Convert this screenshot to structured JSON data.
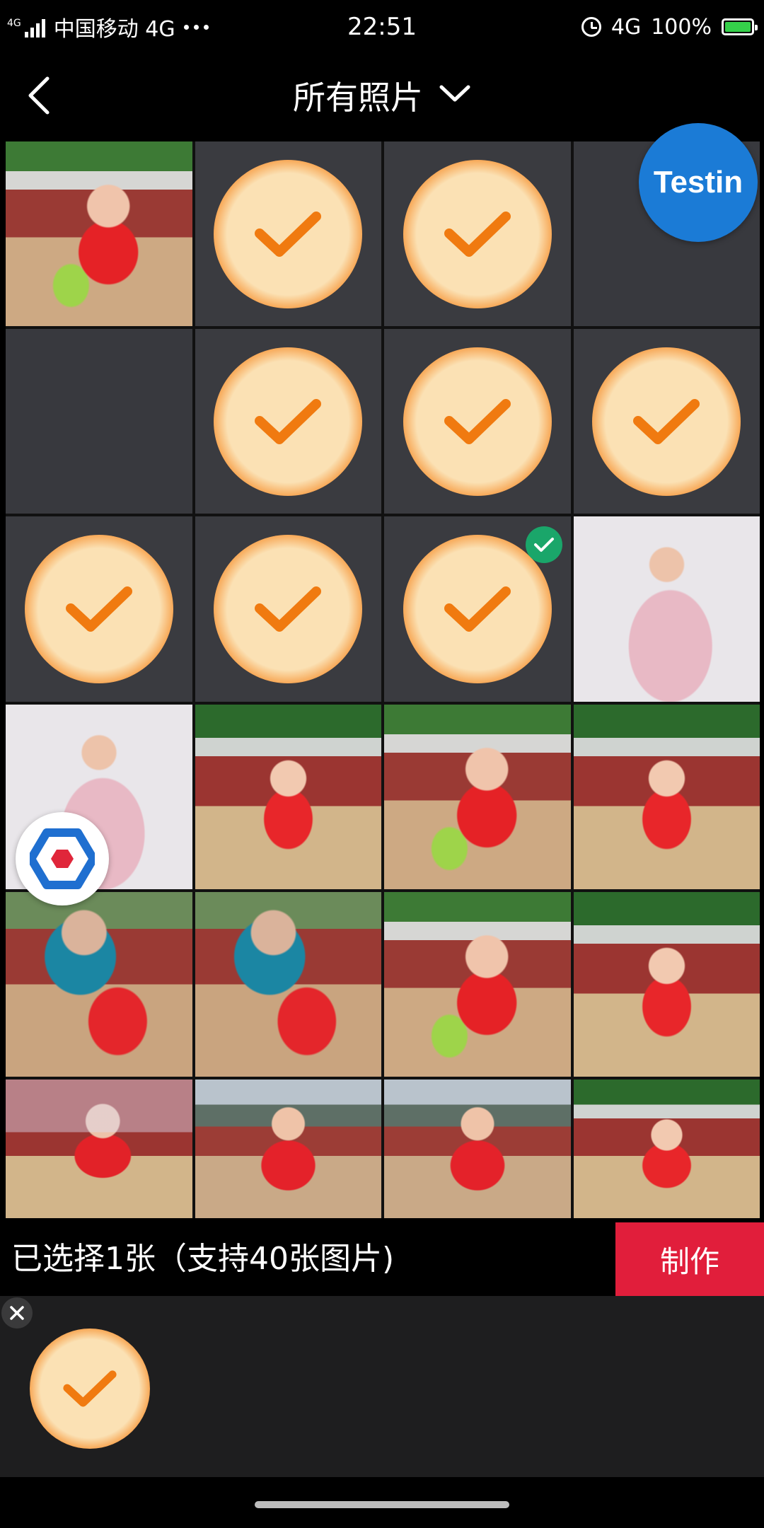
{
  "status_bar": {
    "network_tag": "4G",
    "carrier": "中国移动 4G",
    "time": "22:51",
    "network": "4G",
    "battery": "100%",
    "icons": [
      "signal-icon",
      "more-icon",
      "alarm-icon",
      "battery-charging-icon"
    ]
  },
  "header": {
    "title": "所有照片",
    "back_icon": "back-arrow-icon",
    "dropdown_icon": "chevron-down-icon"
  },
  "floating": {
    "testin_label": "Testin",
    "assistant_icon": "hexagon-assistant-icon"
  },
  "grid": {
    "rows": [
      [
        "photo",
        "check",
        "check",
        "empty"
      ],
      [
        "empty",
        "check",
        "check",
        "check"
      ],
      [
        "check",
        "check",
        "check-selected",
        "photo"
      ],
      [
        "photo",
        "photo",
        "photo",
        "photo"
      ],
      [
        "photo",
        "photo",
        "photo",
        "photo"
      ],
      [
        "photo",
        "photo",
        "photo",
        "photo"
      ]
    ],
    "selected_count": 1
  },
  "selection": {
    "text": "已选择1张（支持40张图片)",
    "make_label": "制作"
  },
  "colors": {
    "accent_red": "#e11e3b",
    "testin_blue": "#1b7bd6",
    "selected_green": "#1aa66a",
    "check_orange": "#ee7a12"
  }
}
